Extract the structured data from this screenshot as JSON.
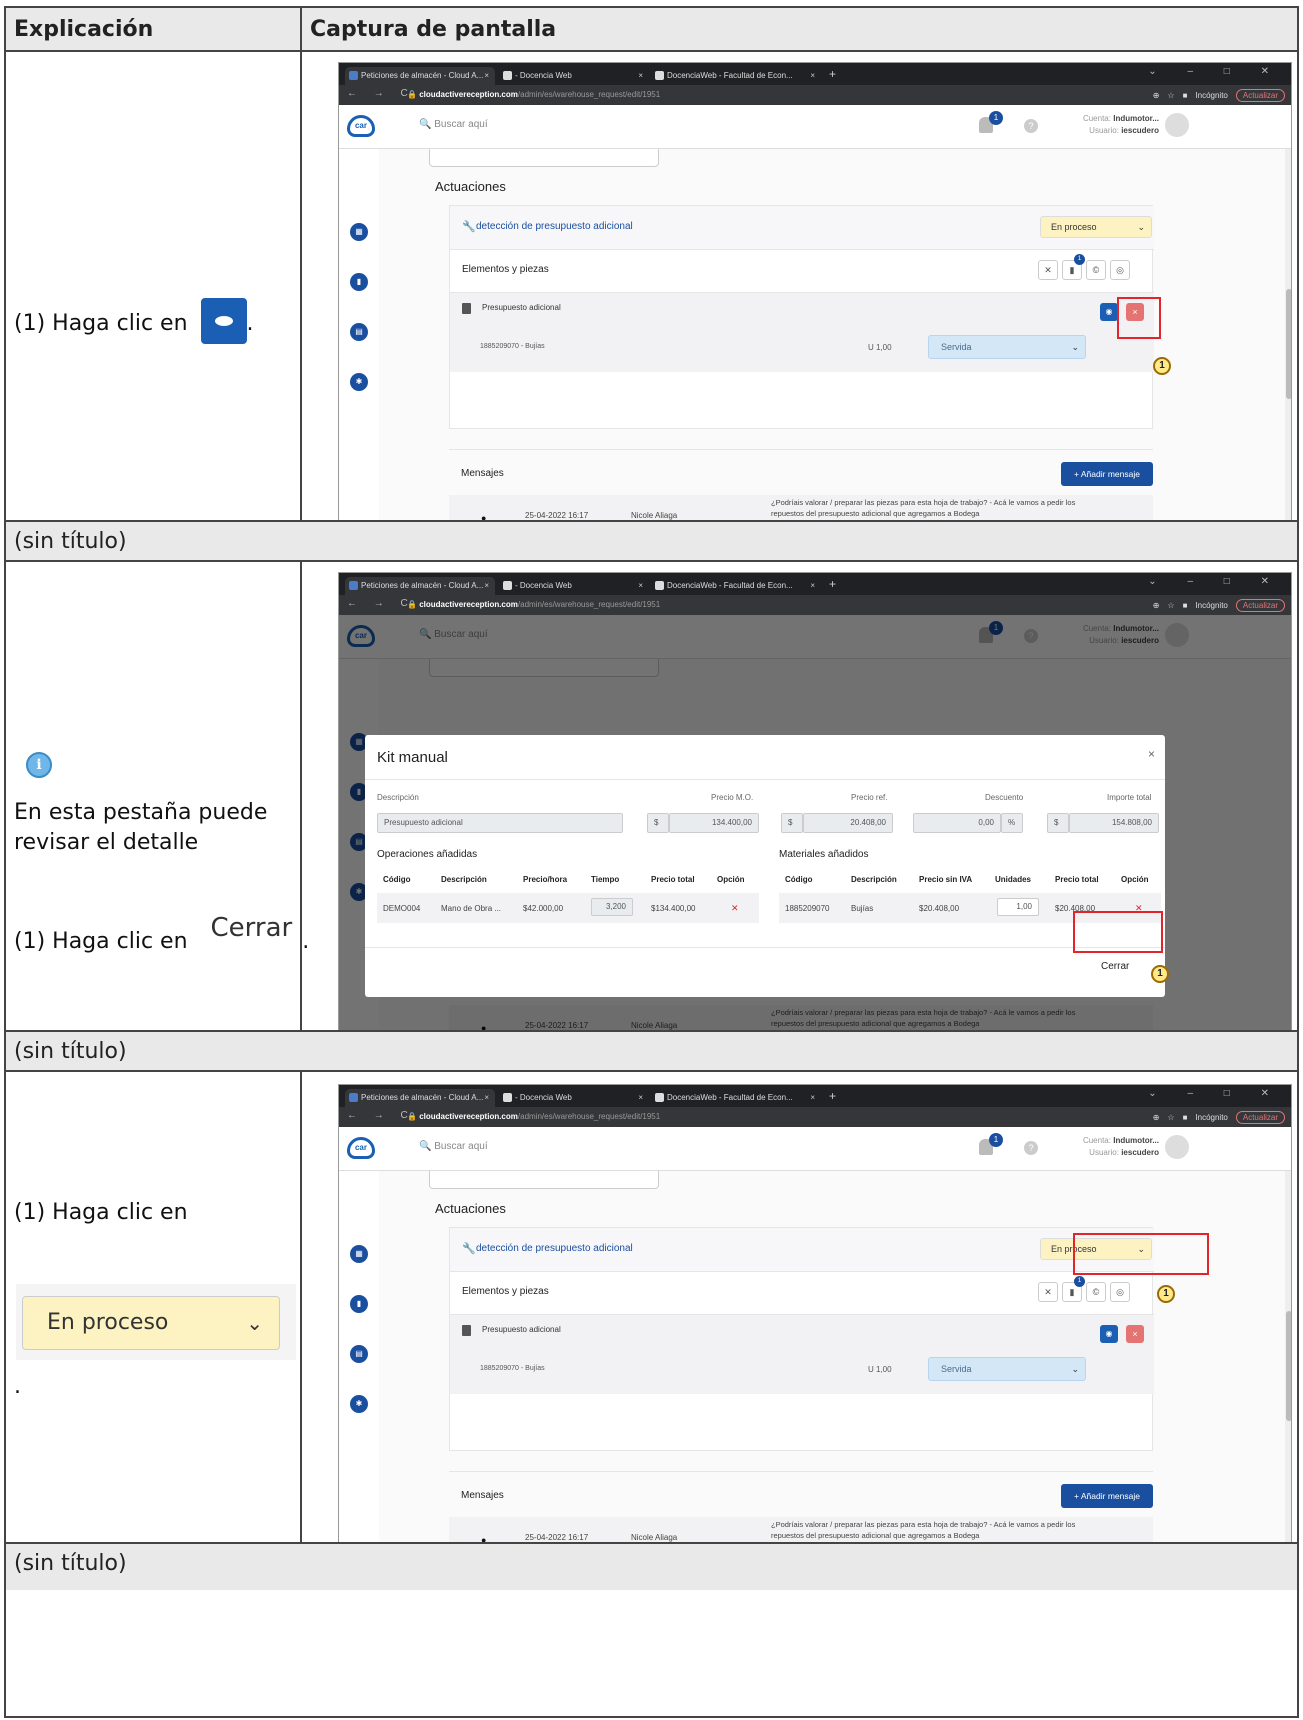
{
  "table": {
    "header_explicacion": "Explicación",
    "header_captura": "Captura de pantalla"
  },
  "browser": {
    "tabs": [
      "Peticiones de almacén - Cloud A...",
      "- Docencia Web",
      "DocenciaWeb - Facultad de Econ..."
    ],
    "url_host": "cloudactivereception.com",
    "url_path": "/admin/es/warehouse_request/edit/1951",
    "incognito": "Incógnito",
    "update": "Actualizar"
  },
  "app": {
    "search_placeholder": "Buscar aquí",
    "notif_count": "1",
    "account_label": "Cuenta:",
    "account_name": "Indumotor...",
    "user_label": "Usuario:",
    "user_name": "iescudero",
    "actuaciones": "Actuaciones",
    "job_title": "detección de presupuesto adicional",
    "status_value": "En proceso",
    "elements_title": "Elementos y piezas",
    "tool_badge": "1",
    "item_name": "Presupuesto adicional",
    "part_name": "1885209070 - Bujías",
    "part_qty": "U  1,00",
    "part_status": "Servida",
    "messages_title": "Mensajes",
    "add_message": "+ Añadir mensaje",
    "msg_date": "25-04-2022 16:17",
    "msg_author": "Nicole Aliaga",
    "msg_text": "¿Podríais valorar / preparar las piezas para esta hoja de trabajo? - Acá le vamos a pedir los repuestos del presupuesto adicional que agregamos a Bodega"
  },
  "callout_number": "1",
  "steps": [
    {
      "prefix": "(1) Haga clic en",
      "suffix": ".",
      "caption": "(sin título)"
    },
    {
      "info_text": "En esta pestaña puede revisar el detalle",
      "prefix": "(1) Haga clic en",
      "button_image_text": "Cerrar",
      "suffix": ".",
      "caption": "(sin título)"
    },
    {
      "prefix": "(1) Haga clic en",
      "select_image_text": "En proceso",
      "suffix": ".",
      "caption": "(sin título)"
    }
  ],
  "modal": {
    "title": "Kit manual",
    "close_icon": "×",
    "lbl_descripcion": "Descripción",
    "lbl_precio_mo": "Precio M.O.",
    "lbl_precio_ref": "Precio ref.",
    "lbl_descuento": "Descuento",
    "lbl_importe": "Importe total",
    "val_descripcion": "Presupuesto adicional",
    "currency": "$",
    "val_precio_mo": "134.400,00",
    "val_precio_ref": "20.408,00",
    "val_descuento": "0,00",
    "percent": "%",
    "val_importe": "154.808,00",
    "ops_title": "Operaciones añadidas",
    "ops_headers": [
      "Código",
      "Descripción",
      "Precio/hora",
      "Tiempo",
      "Precio total",
      "Opción"
    ],
    "ops_row": [
      "DEMO004",
      "Mano de Obra ...",
      "$42.000,00",
      "3,200",
      "$134.400,00"
    ],
    "mat_title": "Materiales añadidos",
    "mat_headers": [
      "Código",
      "Descripción",
      "Precio sin IVA",
      "Unidades",
      "Precio total",
      "Opción"
    ],
    "mat_row": [
      "1885209070",
      "Bujías",
      "$20.408,00",
      "1,00",
      "$20.408,00"
    ],
    "close_button": "Cerrar"
  }
}
